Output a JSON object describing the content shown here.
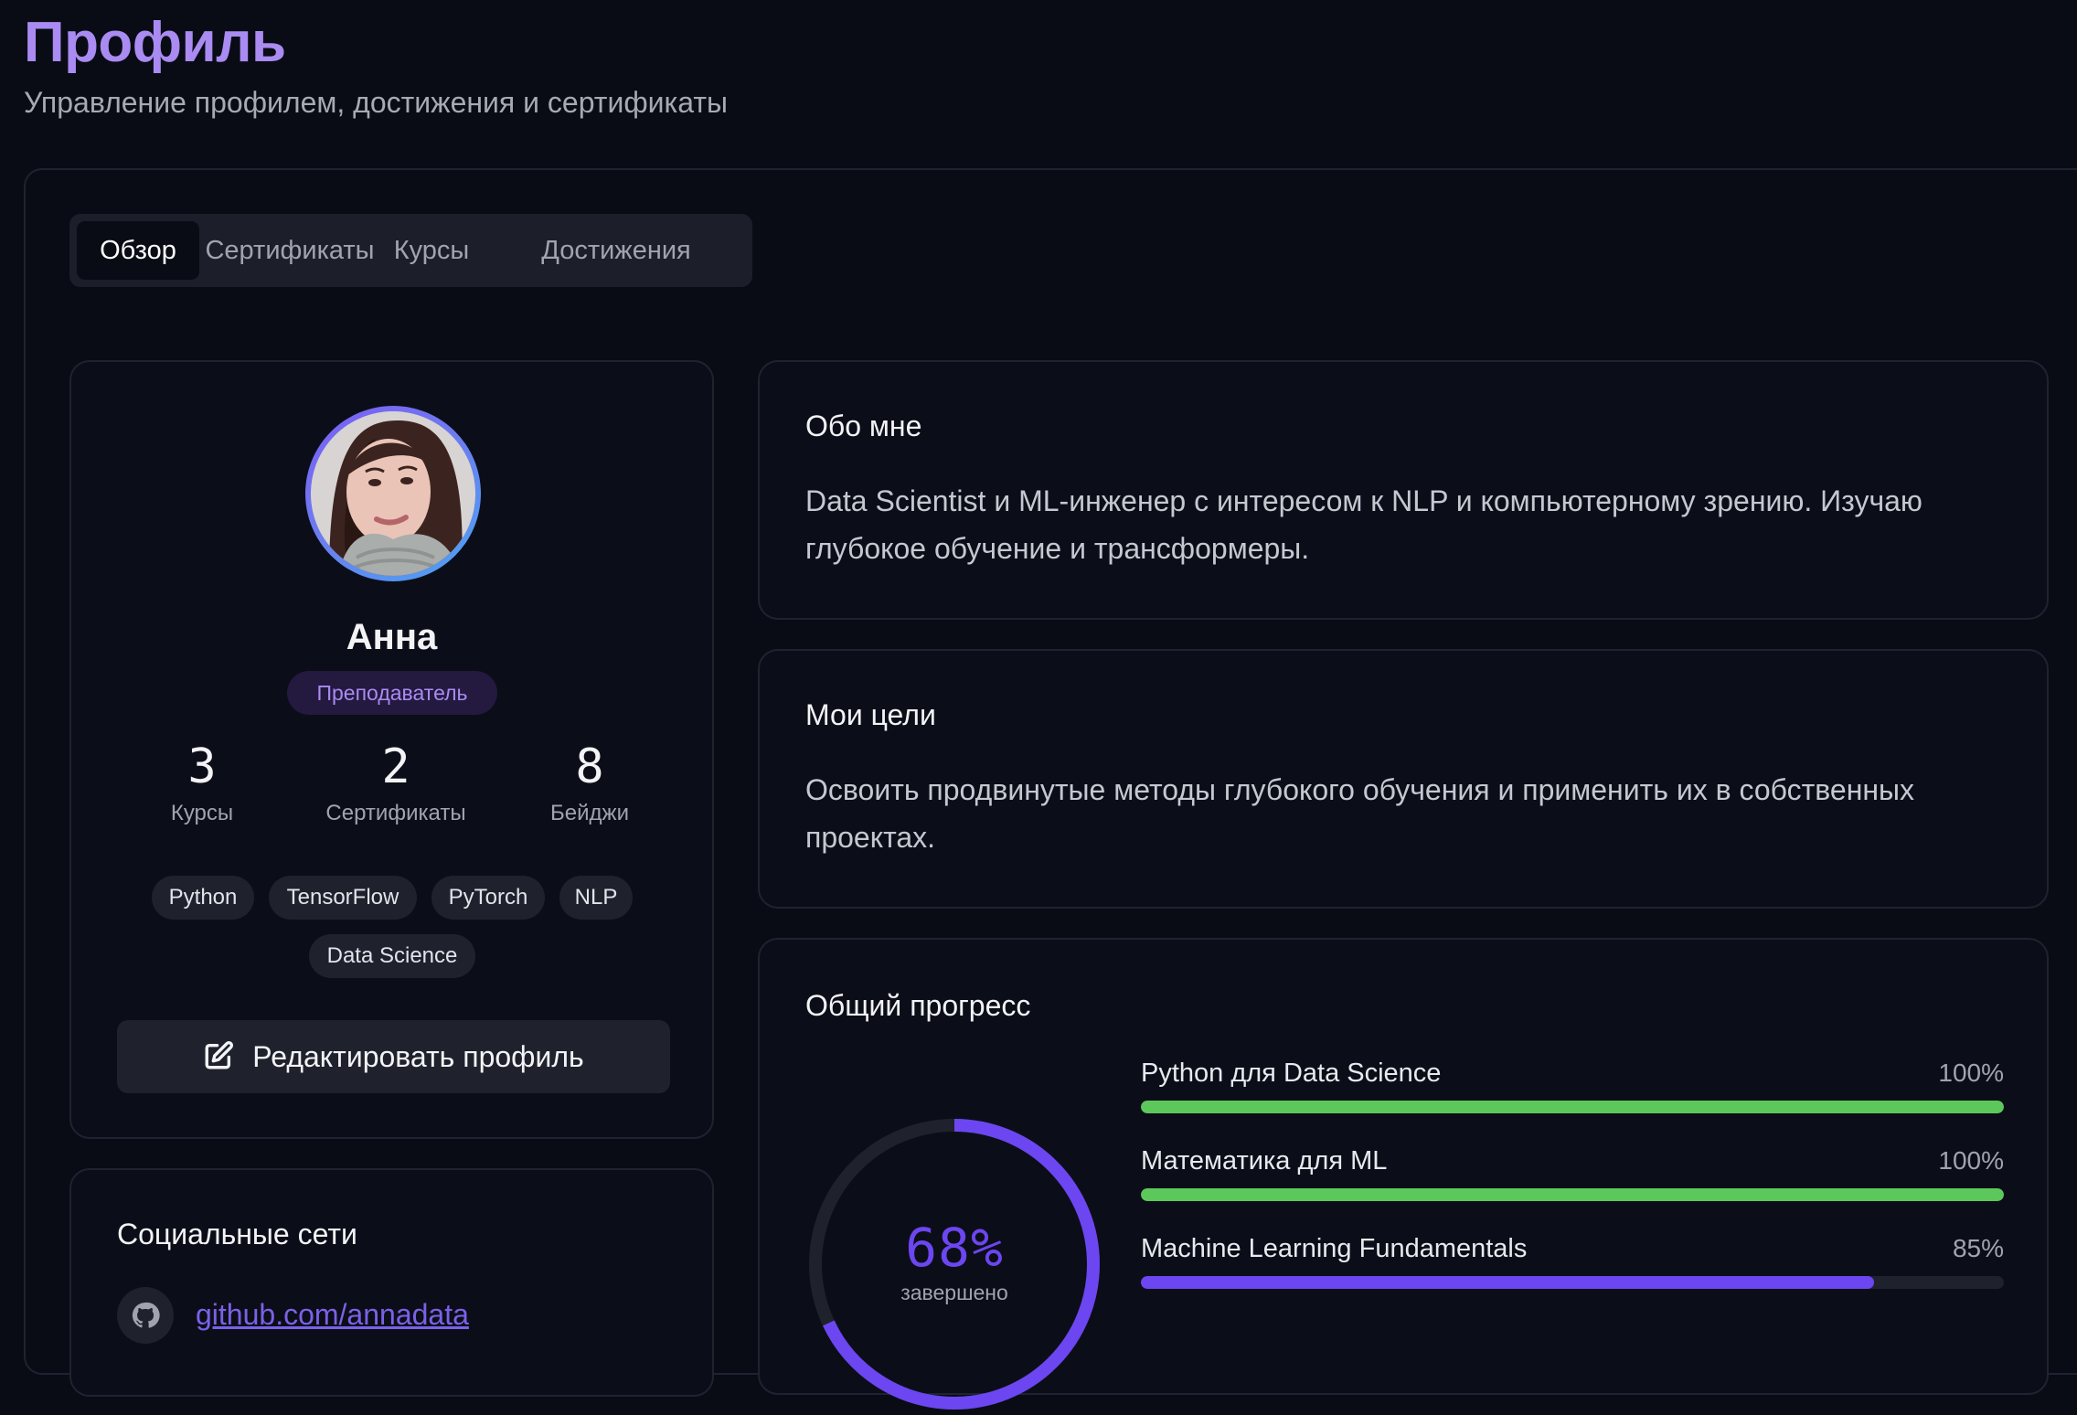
{
  "header": {
    "title": "Профиль",
    "subtitle": "Управление профилем, достижения и сертификаты"
  },
  "tabs": [
    {
      "label": "Обзор",
      "active": true
    },
    {
      "label": "Сертификаты",
      "active": false
    },
    {
      "label": "Курсы",
      "active": false
    },
    {
      "label": "Достижения",
      "active": false
    }
  ],
  "profile": {
    "name": "Анна",
    "role": "Преподаватель",
    "stats": [
      {
        "value": "3",
        "label": "Курсы"
      },
      {
        "value": "2",
        "label": "Сертификаты"
      },
      {
        "value": "8",
        "label": "Бейджи"
      }
    ],
    "skills": [
      "Python",
      "TensorFlow",
      "PyTorch",
      "NLP",
      "Data Science"
    ],
    "edit_button_label": "Редактировать профиль"
  },
  "about": {
    "title": "Обо мне",
    "text": "Data Scientist и ML-инженер с интересом к NLP и компьютерному зрению. Изучаю глубокое обучение и трансформеры."
  },
  "goals": {
    "title": "Мои цели",
    "text": "Освоить продвинутые методы глубокого обучения и применить их в собственных проектах."
  },
  "social": {
    "title": "Социальные сети",
    "links": [
      {
        "icon": "github-icon",
        "text": "github.com/annadata"
      }
    ]
  },
  "progress": {
    "title": "Общий прогресс",
    "overall_percent": 68,
    "overall_label": "68%",
    "overall_caption": "завершено",
    "courses": [
      {
        "name": "Python для Data Science",
        "percent": 100,
        "label": "100%",
        "color": "#5cc85c"
      },
      {
        "name": "Математика для ML",
        "percent": 100,
        "label": "100%",
        "color": "#5cc85c"
      },
      {
        "name": "Machine Learning Fundamentals",
        "percent": 85,
        "label": "85%",
        "color": "#6c46f0"
      }
    ]
  },
  "colors": {
    "accent": "#a98bf2",
    "progress_purple": "#6c46f0",
    "progress_green": "#5cc85c",
    "background": "#090c15"
  }
}
